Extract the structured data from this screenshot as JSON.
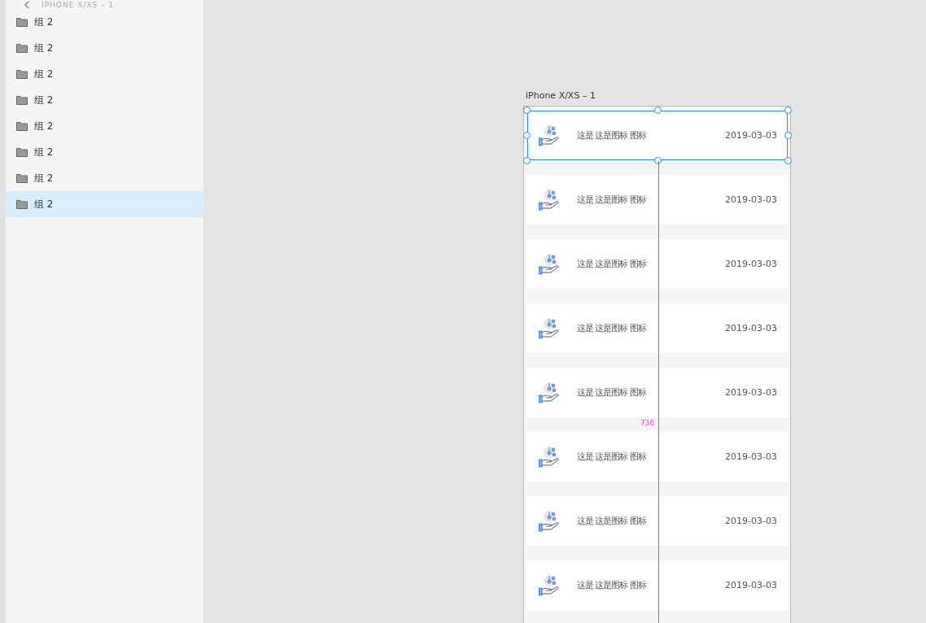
{
  "sidebar": {
    "title": "IPHONE X/XS – 1",
    "items": [
      {
        "label": "组 2",
        "selected": false
      },
      {
        "label": "组 2",
        "selected": false
      },
      {
        "label": "组 2",
        "selected": false
      },
      {
        "label": "组 2",
        "selected": false
      },
      {
        "label": "组 2",
        "selected": false
      },
      {
        "label": "组 2",
        "selected": false
      },
      {
        "label": "组 2",
        "selected": false
      },
      {
        "label": "组 2",
        "selected": true
      }
    ]
  },
  "artboard": {
    "title": "iPhone X/XS – 1",
    "height_label": "736",
    "rows": [
      {
        "text": "这是 这是图标 图标",
        "date": "2019-03-03",
        "selected": true
      },
      {
        "text": "这是 这是图标 图标",
        "date": "2019-03-03",
        "selected": false
      },
      {
        "text": "这是 这是图标 图标",
        "date": "2019-03-03",
        "selected": false
      },
      {
        "text": "这是 这是图标 图标",
        "date": "2019-03-03",
        "selected": false
      },
      {
        "text": "这是 这是图标 图标",
        "date": "2019-03-03",
        "selected": false
      },
      {
        "text": "这是 这是图标 图标",
        "date": "2019-03-03",
        "selected": false
      },
      {
        "text": "这是 这是图标 图标",
        "date": "2019-03-03",
        "selected": false
      },
      {
        "text": "这是 这是图标 图标",
        "date": "2019-03-03",
        "selected": false
      }
    ]
  }
}
